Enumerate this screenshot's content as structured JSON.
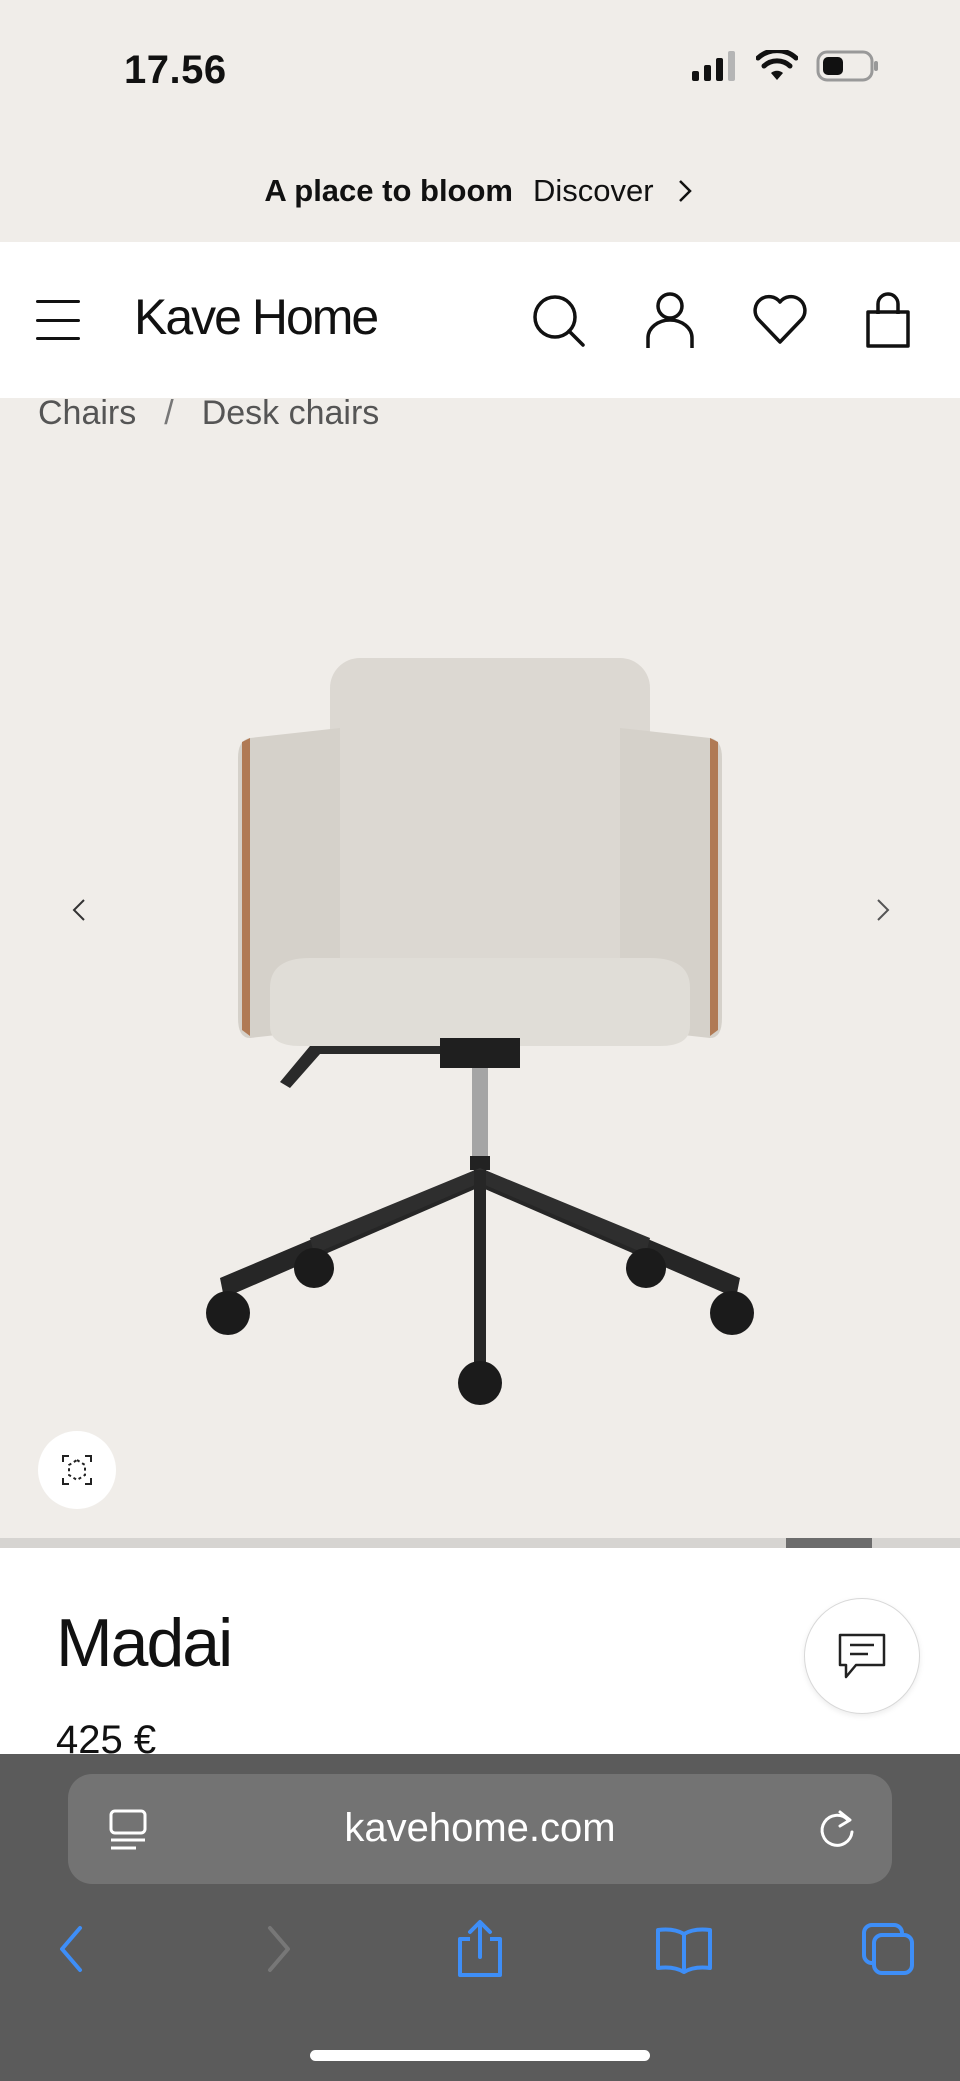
{
  "status_bar": {
    "time": "17.56"
  },
  "promo": {
    "title": "A place to bloom",
    "link": "Discover"
  },
  "header": {
    "logo": "Kave Home"
  },
  "breadcrumb": {
    "items": [
      "Chairs",
      "Desk chairs"
    ],
    "separator": "/"
  },
  "product": {
    "name": "Madai",
    "price": "425 €"
  },
  "browser": {
    "url": "kavehome.com"
  },
  "colors": {
    "page_bg": "#f0ede9",
    "chrome_bg": "#5b5b5b",
    "toolbar_icon": "#3e8ef7"
  },
  "icons": [
    "signal-icon",
    "wifi-icon",
    "battery-icon",
    "chevron-right-icon",
    "menu-icon",
    "search-icon",
    "account-icon",
    "heart-icon",
    "bag-icon",
    "chevron-left-icon",
    "ar-view-icon",
    "chat-icon",
    "reader-icon",
    "reload-icon",
    "back-icon",
    "forward-icon",
    "share-icon",
    "bookmarks-icon",
    "tabs-icon"
  ]
}
